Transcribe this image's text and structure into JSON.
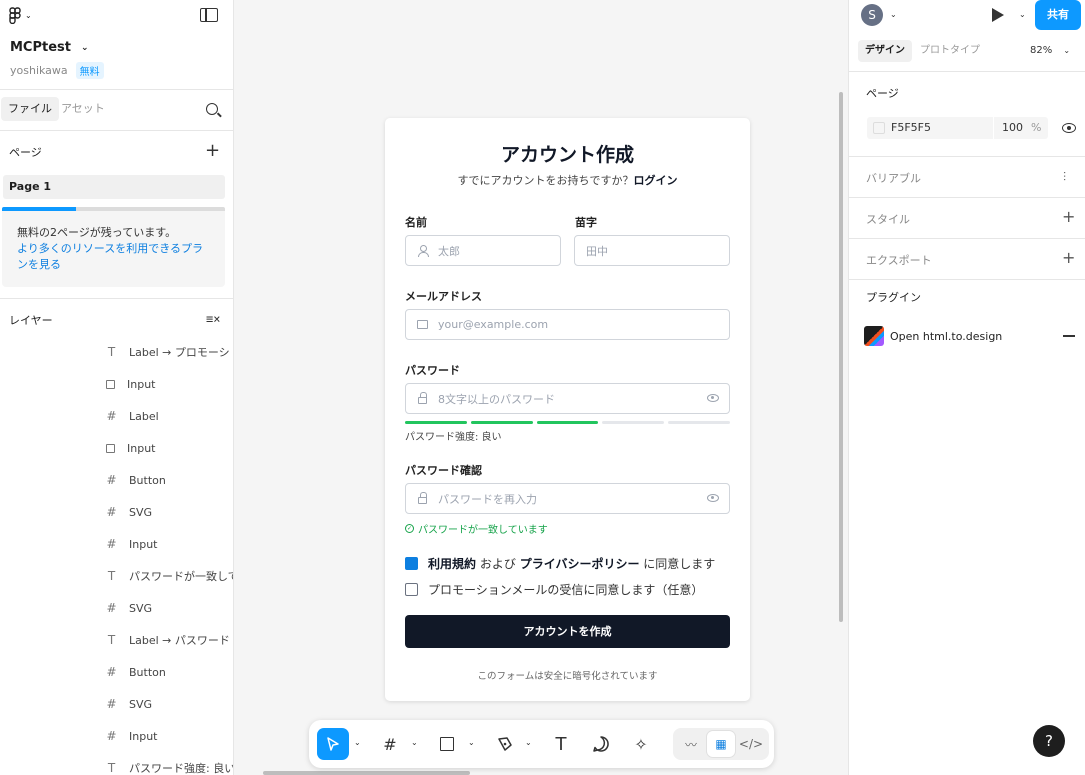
{
  "file": {
    "name": "MCPtest",
    "owner": "yoshikawa",
    "plan_badge": "無料"
  },
  "left_panel": {
    "tab_file": "ファイル",
    "tab_assets": "アセット",
    "pages_label": "ページ",
    "page_item": "Page 1",
    "pages_notice": "無料の2ページが残っています。",
    "pages_link": "より多くのリソースを利用できるプランを見る",
    "pages_used_fraction": 0.33,
    "layers_label": "レイヤー",
    "layers": [
      {
        "type": "text",
        "label": "Label → プロモーシ"
      },
      {
        "type": "rect",
        "label": "Input"
      },
      {
        "type": "frame",
        "label": "Label"
      },
      {
        "type": "rect",
        "label": "Input"
      },
      {
        "type": "frame",
        "label": "Button"
      },
      {
        "type": "frame",
        "label": "SVG"
      },
      {
        "type": "frame",
        "label": "Input"
      },
      {
        "type": "text",
        "label": "パスワードが一致して"
      },
      {
        "type": "frame",
        "label": "SVG"
      },
      {
        "type": "text",
        "label": "Label → パスワード"
      },
      {
        "type": "frame",
        "label": "Button"
      },
      {
        "type": "frame",
        "label": "SVG"
      },
      {
        "type": "frame",
        "label": "Input"
      },
      {
        "type": "text",
        "label": "パスワード強度: 良い"
      }
    ]
  },
  "form": {
    "title": "アカウント作成",
    "subtitle_prefix": "すでにアカウントをお持ちですか？",
    "subtitle_link": "ログイン",
    "first_name_label": "名前",
    "first_name_placeholder": "太郎",
    "last_name_label": "苗字",
    "last_name_placeholder": "田中",
    "email_label": "メールアドレス",
    "email_placeholder": "your@example.com",
    "password_label": "パスワード",
    "password_placeholder": "8文字以上のパスワード",
    "strength_segments_filled": 3,
    "strength_segments_total": 5,
    "strength_text": "パスワード強度: 良い",
    "confirm_label": "パスワード確認",
    "confirm_placeholder": "パスワードを再入力",
    "match_text": "パスワードが一致しています",
    "terms_bold1": "利用規約",
    "terms_mid": "および",
    "terms_bold2": "プライバシーポリシー",
    "terms_end": "に同意します",
    "terms_checked": true,
    "promo_text": "プロモーションメールの受信に同意します（任意）",
    "promo_checked": false,
    "submit_label": "アカウントを作成",
    "footer_note": "このフォームは安全に暗号化されています"
  },
  "right_panel": {
    "avatar_initial": "S",
    "share_label": "共有",
    "tab_design": "デザイン",
    "tab_prototype": "プロトタイプ",
    "zoom": "82%",
    "page_section": "ページ",
    "page_color_hex": "F5F5F5",
    "page_opacity": "100",
    "page_opacity_unit": "%",
    "variables": "バリアブル",
    "styles": "スタイル",
    "export": "エクスポート",
    "plugins": "プラグイン",
    "plugin_name": "Open html.to.design"
  },
  "help": "?",
  "colors": {
    "accent": "#0d99ff",
    "submit_bg": "#111827",
    "success": "#22c55e"
  }
}
